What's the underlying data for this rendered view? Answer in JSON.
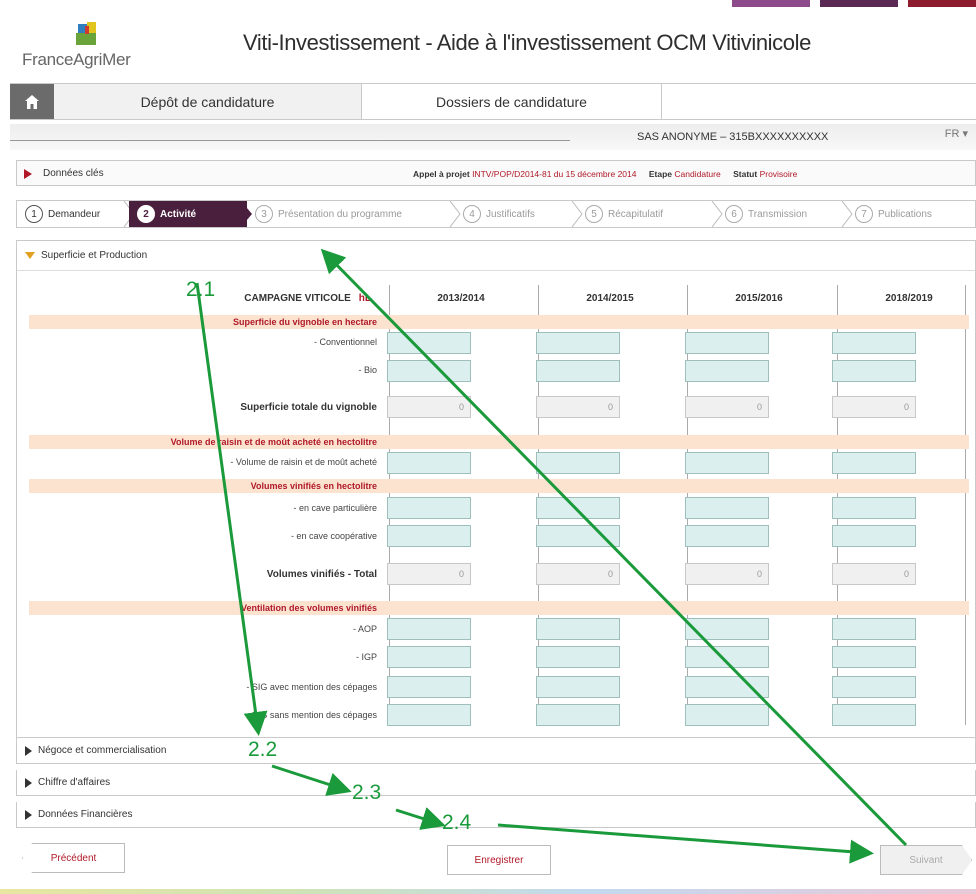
{
  "header": {
    "brand": "FranceAgriMer",
    "title": "Viti-Investissement - Aide à l'investissement OCM Vitivinicole"
  },
  "nav": {
    "tabs": [
      "Dépôt de candidature",
      "Dossiers de candidature"
    ]
  },
  "userbar": {
    "user": "SAS ANONYME – 315BXXXXXXXXXX",
    "lang": "FR ▾"
  },
  "keydata": {
    "label": "Données clés",
    "appel_label": "Appel à projet",
    "appel_value": "INTV/POP/D2014-81 du 15 décembre 2014",
    "etape_label": "Etape",
    "etape_value": "Candidature",
    "statut_label": "Statut",
    "statut_value": "Provisoire"
  },
  "steps": [
    {
      "num": "1",
      "label": "Demandeur"
    },
    {
      "num": "2",
      "label": "Activité"
    },
    {
      "num": "3",
      "label": "Présentation du programme"
    },
    {
      "num": "4",
      "label": "Justificatifs"
    },
    {
      "num": "5",
      "label": "Récapitulatif"
    },
    {
      "num": "6",
      "label": "Transmission"
    },
    {
      "num": "7",
      "label": "Publications"
    }
  ],
  "panel": {
    "title": "Superficie et Production",
    "campagne_label": "CAMPAGNE VITICOLE",
    "unit": "hL",
    "columns": [
      "2013/2014",
      "2014/2015",
      "2015/2016",
      "2018/2019"
    ],
    "bands": [
      "Superficie du vignoble en hectare",
      "Volume de raisin et de moût acheté en hectolitre",
      "Volumes vinifiés en hectolitre",
      "Ventilation des volumes vinifiés"
    ],
    "rows": {
      "conventionnel": "- Conventionnel",
      "bio": "- Bio",
      "superficie_totale": "Superficie totale du vignoble",
      "volume_achete": "- Volume de raisin et de moût acheté",
      "cave_part": "- en cave particulière",
      "cave_coop": "- en cave coopérative",
      "volumes_total": "Volumes vinifiés - Total",
      "aop": "- AOP",
      "igp": "- IGP",
      "sig_avec": "- SIG avec mention des cépages",
      "sig_sans": "- SIG sans mention des cépages"
    },
    "total_value": "0"
  },
  "sections": [
    "Négoce et commercialisation",
    "Chiffre d'affaires",
    "Données Financières"
  ],
  "buttons": {
    "prev": "Précédent",
    "save": "Enregistrer",
    "next": "Suivant"
  },
  "annotations": [
    "2.1",
    "2.2",
    "2.3",
    "2.4"
  ],
  "colors": {
    "accent": "#4a1f3d",
    "alert": "#b01928",
    "annotation": "#1a9a3a",
    "input": "#dbefee",
    "band": "#fbe3cf"
  }
}
